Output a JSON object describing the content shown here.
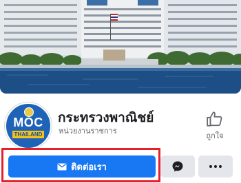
{
  "page": {
    "name": "กระทรวงพาณิชย์",
    "category": "หน่วยงานราชการ"
  },
  "avatar": {
    "logo_text": "MOC",
    "logo_subtext": "THAILAND"
  },
  "like": {
    "label": "ถูกใจ",
    "icon": "thumbs-up-icon"
  },
  "actions": {
    "contact_label": "ติดต่อเรา",
    "contact_icon": "envelope-icon",
    "messenger_icon": "messenger-icon",
    "more_icon": "more-icon"
  },
  "colors": {
    "primary": "#1877f2",
    "secondary_button": "#e4e6eb",
    "highlight": "#e5202b",
    "logo_blue": "#1e63b8",
    "logo_yellow": "#f4c21b"
  }
}
